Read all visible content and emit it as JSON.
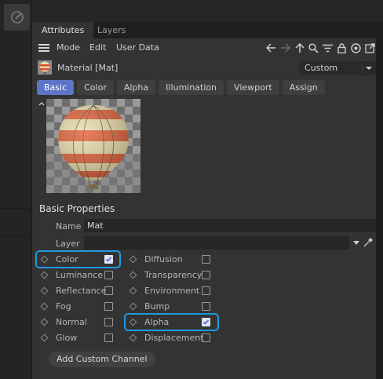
{
  "tabs": {
    "attributes": "Attributes",
    "layers": "Layers"
  },
  "menu": {
    "mode": "Mode",
    "edit": "Edit",
    "user_data": "User Data"
  },
  "material": {
    "title": "Material [Mat]"
  },
  "mode_dropdown": {
    "value": "Custom"
  },
  "property_tabs": [
    "Basic",
    "Color",
    "Alpha",
    "Illumination",
    "Viewport",
    "Assign"
  ],
  "section": {
    "title": "Basic Properties"
  },
  "fields": {
    "name_label": "Name",
    "name_value": "Mat",
    "layer_label": "Layer",
    "layer_value": ""
  },
  "channels_left": [
    {
      "label": "Color",
      "checked": true
    },
    {
      "label": "Luminance",
      "checked": false
    },
    {
      "label": "Reflectance",
      "checked": false
    },
    {
      "label": "Fog",
      "checked": false
    },
    {
      "label": "Normal",
      "checked": false
    },
    {
      "label": "Glow",
      "checked": false
    }
  ],
  "channels_right": [
    {
      "label": "Diffusion",
      "checked": false
    },
    {
      "label": "Transparency",
      "checked": false
    },
    {
      "label": "Environment",
      "checked": false
    },
    {
      "label": "Bump",
      "checked": false
    },
    {
      "label": "Alpha",
      "checked": true
    },
    {
      "label": "Displacement",
      "checked": false
    }
  ],
  "add_button": "Add Custom Channel",
  "colors": {
    "accent": "#5d74c7",
    "highlight": "#1e9be0",
    "panel": "#333333"
  },
  "icons": [
    "edit-tool-icon",
    "hamburger-icon",
    "back-arrow-icon",
    "forward-arrow-icon",
    "up-arrow-icon",
    "search-icon",
    "filter-icon",
    "lock-icon",
    "target-icon",
    "new-window-icon",
    "eyedropper-icon",
    "chevron-down-icon"
  ]
}
